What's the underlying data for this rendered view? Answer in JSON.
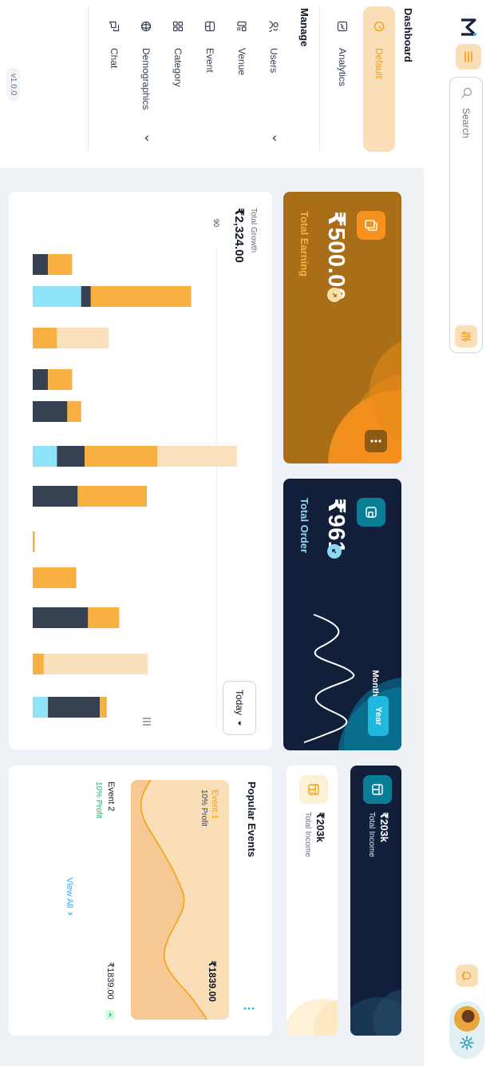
{
  "header": {
    "search_placeholder": "Search"
  },
  "sidebar": {
    "dashboard_title": "Dashboard",
    "dashboard_items": [
      {
        "label": "Default",
        "icon": "dashboard-icon",
        "active": true
      },
      {
        "label": "Analytics",
        "icon": "analytics-icon",
        "active": false
      }
    ],
    "manage_title": "Manage",
    "manage_items": [
      {
        "label": "Users",
        "icon": "users-icon"
      },
      {
        "label": "Venue",
        "icon": "venue-icon"
      },
      {
        "label": "Event",
        "icon": "event-icon"
      },
      {
        "label": "Category",
        "icon": "category-icon"
      },
      {
        "label": "Demographics",
        "icon": "globe-icon"
      },
      {
        "label": "Chat",
        "icon": "chat-icon"
      }
    ],
    "version": "v1.0.0"
  },
  "cards": {
    "total_earning": {
      "amount": "₹500.00",
      "label": "Total Earning"
    },
    "total_order": {
      "amount": "₹961",
      "label": "Total Order",
      "toggle_month": "Month",
      "toggle_year": "Year"
    },
    "income_dark": {
      "amount": "₹203k",
      "label": "Total Income"
    },
    "income_light": {
      "amount": "₹203k",
      "label": "Total Income"
    }
  },
  "growth": {
    "subtitle": "Total Growth",
    "amount": "₹2,324.00",
    "period": "Today"
  },
  "popular": {
    "title": "Popular Events",
    "events": [
      {
        "name": "Event 1",
        "profit": "10% Profit",
        "amount": "₹1839.00"
      },
      {
        "name": "Event 2",
        "profit": "10% Profit",
        "amount": "₹1839.00"
      }
    ],
    "view_all": "View All"
  },
  "chart_data": {
    "type": "bar",
    "stacked": true,
    "yticks": [
      "90",
      "180",
      "270",
      "360"
    ],
    "grid": true,
    "colors": [
      "#8fe3f7",
      "#364152",
      "#f9b043",
      "#f9e0bc"
    ],
    "bars": [
      {
        "s1": 0,
        "s2": 22,
        "s3": 35,
        "s4": 0
      },
      {
        "s1": 70,
        "s2": 14,
        "s3": 145,
        "s4": 0
      },
      {
        "s1": 0,
        "s2": 0,
        "s3": 35,
        "s4": 75
      },
      {
        "s1": 0,
        "s2": 22,
        "s3": 35,
        "s4": 0
      },
      {
        "s1": 0,
        "s2": 50,
        "s3": 20,
        "s4": 0
      },
      {
        "s1": 35,
        "s2": 40,
        "s3": 105,
        "s4": 115
      },
      {
        "s1": 0,
        "s2": 65,
        "s3": 100,
        "s4": 0
      },
      {
        "s1": 0,
        "s2": 0,
        "s3": 3,
        "s4": 0
      },
      {
        "s1": 0,
        "s2": 0,
        "s3": 63,
        "s4": 0
      },
      {
        "s1": 0,
        "s2": 80,
        "s3": 45,
        "s4": 0
      },
      {
        "s1": 0,
        "s2": 0,
        "s3": 16,
        "s4": 150
      },
      {
        "s1": 22,
        "s2": 75,
        "s3": 10,
        "s4": 0
      }
    ]
  }
}
